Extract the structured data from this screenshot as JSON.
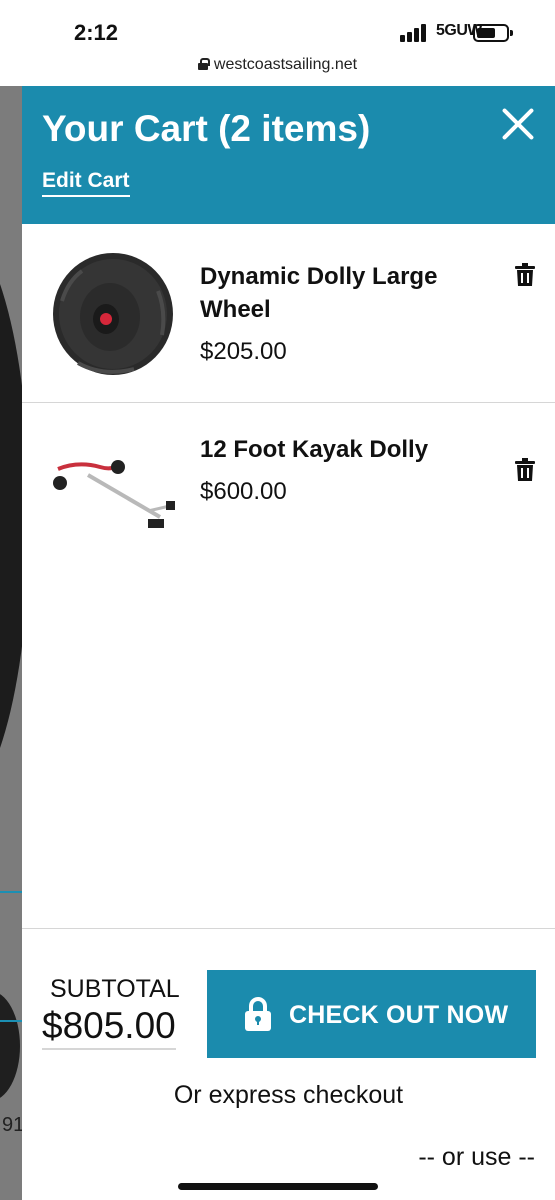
{
  "status_bar": {
    "time": "2:12",
    "network": "5GUW",
    "signal_bars": 4
  },
  "browser": {
    "url": "westcoastsailing.net"
  },
  "background_page": {
    "partial_text": "91"
  },
  "cart": {
    "title": "Your Cart (2 items)",
    "edit_label": "Edit Cart",
    "close_icon": "close-icon",
    "items": [
      {
        "name": "Dynamic Dolly Large Wheel",
        "price": "$205.00",
        "image": "wheel-image",
        "remove_icon": "trash-icon"
      },
      {
        "name": "12 Foot Kayak Dolly",
        "price": "$600.00",
        "image": "kayak-dolly-image",
        "remove_icon": "trash-icon"
      }
    ],
    "subtotal_label": "SUBTOTAL",
    "subtotal_value": "$805.00",
    "checkout_label": "CHECK OUT NOW",
    "checkout_icon": "lock-icon",
    "express_label": "Or express checkout",
    "or_use_label": "-- or use --"
  },
  "colors": {
    "brand": "#1b8bad",
    "text": "#111111",
    "divider": "#d6d6d6",
    "overlay": "#7c7c7c"
  }
}
